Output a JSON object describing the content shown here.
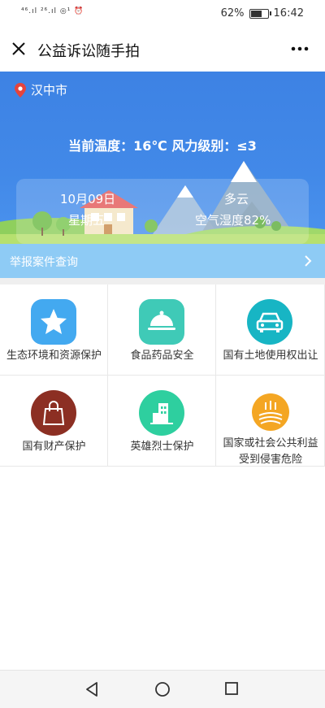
{
  "status_bar": {
    "left_indicators": "⁴⁶.ıl ²⁶.ıl ◎¹ ⏰",
    "battery": "62%",
    "battery_level": 0.62,
    "time": "16:42"
  },
  "title_bar": {
    "title": "公益诉讼随手拍",
    "close_icon": "close-icon",
    "more_icon": "more-icon"
  },
  "weather": {
    "city": "汉中市",
    "temp_wind": "当前温度：16℃  风力级别：≤3",
    "date": "10月09日",
    "weekday": "星期五",
    "condition": "多云",
    "humidity": "空气湿度82%"
  },
  "report": {
    "label": "举报案件查询"
  },
  "categories": [
    {
      "label": "生态环境和资源保护",
      "icon": "star-icon",
      "color": "#43a9f0"
    },
    {
      "label": "食品药品安全",
      "icon": "food-cover-icon",
      "color": "#3fcab7"
    },
    {
      "label": "国有土地使用权出让",
      "icon": "car-icon",
      "color": "#17b5c4"
    },
    {
      "label": "国有财产保护",
      "icon": "shopping-bag-icon",
      "color": "#8c2f23"
    },
    {
      "label": "英雄烈士保护",
      "icon": "building-icon",
      "color": "#2ecf9f"
    },
    {
      "label": "国家或社会公共利益受到侵害危险",
      "label_line1": "国家或社会公共利益",
      "label_line2": "受到侵害危险",
      "icon": "field-icon",
      "color": "#f4a623"
    }
  ],
  "colors": {
    "header_blue": "#4289e8",
    "report_bar": "#8ecbf5"
  }
}
